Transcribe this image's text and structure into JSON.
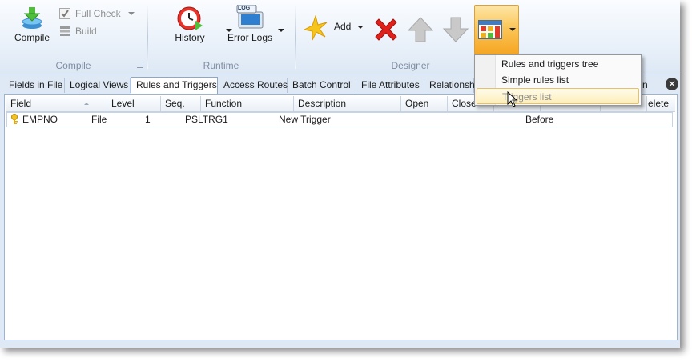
{
  "ribbon": {
    "compile_group": {
      "label": "Compile",
      "compile_label": "Compile",
      "full_check_label": "Full Check",
      "build_label": "Build"
    },
    "runtime_group": {
      "label": "Runtime",
      "history_label": "History",
      "error_logs_label": "Error Logs",
      "log_badge": "LOG"
    },
    "designer_group": {
      "label": "Designer",
      "add_label": "Add"
    }
  },
  "tabs": [
    {
      "label": "Fields in File",
      "active": false
    },
    {
      "label": "Logical Views",
      "active": false
    },
    {
      "label": "Rules and Triggers",
      "active": true
    },
    {
      "label": "Access Routes",
      "active": false
    },
    {
      "label": "Batch Control",
      "active": false
    },
    {
      "label": "File Attributes",
      "active": false
    },
    {
      "label": "Relationsh",
      "active": false
    },
    {
      "label": "n",
      "active": false
    }
  ],
  "close_tabs_glyph": "✕",
  "grid": {
    "columns": [
      "Field",
      "Level",
      "Seq.",
      "Function",
      "Description",
      "Open",
      "Close",
      "",
      "",
      "",
      "elete"
    ],
    "rows": [
      {
        "icon": "key-icon",
        "cells": [
          "EMPNO",
          "File",
          "1",
          "PSLTRG1",
          "New Trigger",
          "",
          "",
          "",
          "Before",
          "",
          ""
        ]
      }
    ]
  },
  "view_menu": {
    "items": [
      {
        "label": "Rules and triggers tree",
        "state": "normal"
      },
      {
        "label": "Simple rules list",
        "state": "normal"
      },
      {
        "label": "Triggers list",
        "state": "hover-disabled"
      }
    ]
  },
  "colors": {
    "ribbon_bg": "#eef4fb",
    "highlight_orange": "#fbc759",
    "delete_red": "#e0201b",
    "disabled_gray": "#8d8d8d"
  }
}
